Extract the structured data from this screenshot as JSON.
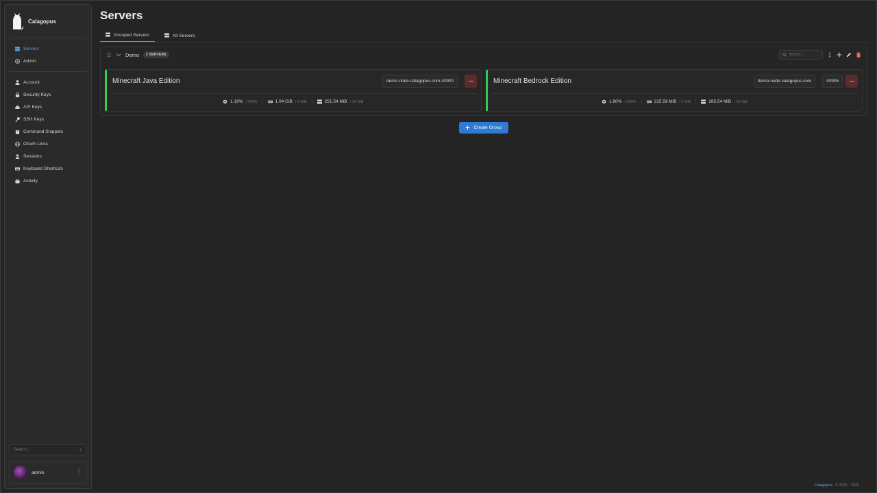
{
  "brand": {
    "name": "Calagopus"
  },
  "sidebar": {
    "primary": [
      {
        "label": "Servers",
        "icon": "servers-icon",
        "active": true
      },
      {
        "label": "Admin",
        "icon": "admin-icon",
        "active": false
      }
    ],
    "account": [
      {
        "label": "Account",
        "icon": "user-icon"
      },
      {
        "label": "Security Keys",
        "icon": "lock-icon"
      },
      {
        "label": "API Keys",
        "icon": "cloud-icon"
      },
      {
        "label": "SSH Keys",
        "icon": "key-icon"
      },
      {
        "label": "Command Snippets",
        "icon": "clipboard-icon"
      },
      {
        "label": "OAuth Links",
        "icon": "globe-icon"
      },
      {
        "label": "Sessions",
        "icon": "user-secret-icon"
      },
      {
        "label": "Keyboard Shortcuts",
        "icon": "keyboard-icon"
      },
      {
        "label": "Activity",
        "icon": "briefcase-icon"
      }
    ],
    "search_placeholder": "Search...",
    "search_shortcut": "⇕",
    "user": {
      "name": "admin"
    }
  },
  "page": {
    "title": "Servers"
  },
  "tabs": [
    {
      "label": "Grouped Servers",
      "active": true
    },
    {
      "label": "All Servers",
      "active": false
    }
  ],
  "group": {
    "name": "Demo",
    "badge": "2 SERVERS",
    "search_placeholder": "Search..."
  },
  "servers": [
    {
      "name": "Minecraft Java Edition",
      "address": "demo-node.calagopus.com:40900",
      "port": "",
      "cpu": "1.19%",
      "cpu_limit": "/ 200%",
      "memory": "1.04 GiB",
      "memory_limit": "/ 4 GiB",
      "disk": "251.54 MiB",
      "disk_limit": "/ 10 GiB"
    },
    {
      "name": "Minecraft Bedrock Edition",
      "address": "demo-node.calagopus.com",
      "port": "40905",
      "cpu": "1.80%",
      "cpu_limit": "/ 200%",
      "memory": "215.59 MiB",
      "memory_limit": "/ 2 GiB",
      "disk": "285.54 MiB",
      "disk_limit": "/ 10 GiB"
    }
  ],
  "create_group_label": "Create Group",
  "footer": {
    "link": "Calagopus",
    "copyright": "© 2025 - 2026"
  },
  "colors": {
    "accent": "#5aa2e8",
    "status_running": "#2fcf52",
    "danger": "#ff8a8a"
  }
}
